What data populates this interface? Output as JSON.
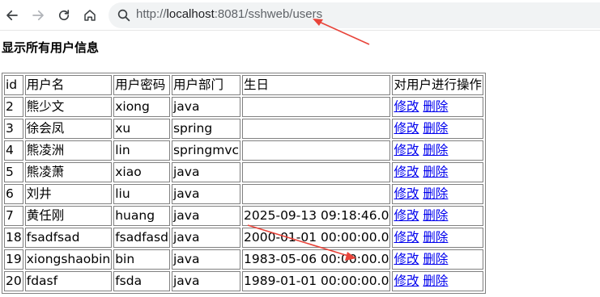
{
  "browser": {
    "url_prefix": "http://",
    "url_host": "localhost",
    "url_path": ":8081/sshweb/users"
  },
  "page": {
    "heading": "显示所有用户信息"
  },
  "table": {
    "headers": [
      "id",
      "用户名",
      "用户密码",
      "用户部门",
      "生日",
      "对用户进行操作"
    ],
    "rows": [
      {
        "id": "2",
        "name": "熊少文",
        "password": "xiong",
        "dept": "java",
        "birthday": "",
        "edit": "修改",
        "delete": "删除"
      },
      {
        "id": "3",
        "name": "徐会凤",
        "password": "xu",
        "dept": "spring",
        "birthday": "",
        "edit": "修改",
        "delete": "删除"
      },
      {
        "id": "4",
        "name": "熊凌洲",
        "password": "lin",
        "dept": "springmvc",
        "birthday": "",
        "edit": "修改",
        "delete": "删除"
      },
      {
        "id": "5",
        "name": "熊凌萧",
        "password": "xiao",
        "dept": "java",
        "birthday": "",
        "edit": "修改",
        "delete": "删除"
      },
      {
        "id": "6",
        "name": "刘井",
        "password": "liu",
        "dept": "java",
        "birthday": "",
        "edit": "修改",
        "delete": "删除"
      },
      {
        "id": "7",
        "name": "黄任刚",
        "password": "huang",
        "dept": "java",
        "birthday": "2025-09-13 09:18:46.0",
        "edit": "修改",
        "delete": "删除"
      },
      {
        "id": "18",
        "name": "fsadfsad",
        "password": "fsadfasd",
        "dept": "java",
        "birthday": "2000-01-01 00:00:00.0",
        "edit": "修改",
        "delete": "删除"
      },
      {
        "id": "19",
        "name": "xiongshaobin",
        "password": "bin",
        "dept": "java",
        "birthday": "1983-05-06 00:00:00.0",
        "edit": "修改",
        "delete": "删除"
      },
      {
        "id": "20",
        "name": "fdasf",
        "password": "fsda",
        "dept": "java",
        "birthday": "1989-01-01 00:00:00.0",
        "edit": "修改",
        "delete": "删除"
      }
    ]
  },
  "colors": {
    "link": "#0000ee",
    "annotation_arrow": "#e8443a"
  },
  "icons": [
    "back-arrow-icon",
    "forward-arrow-icon",
    "reload-icon",
    "home-icon",
    "search-icon"
  ]
}
